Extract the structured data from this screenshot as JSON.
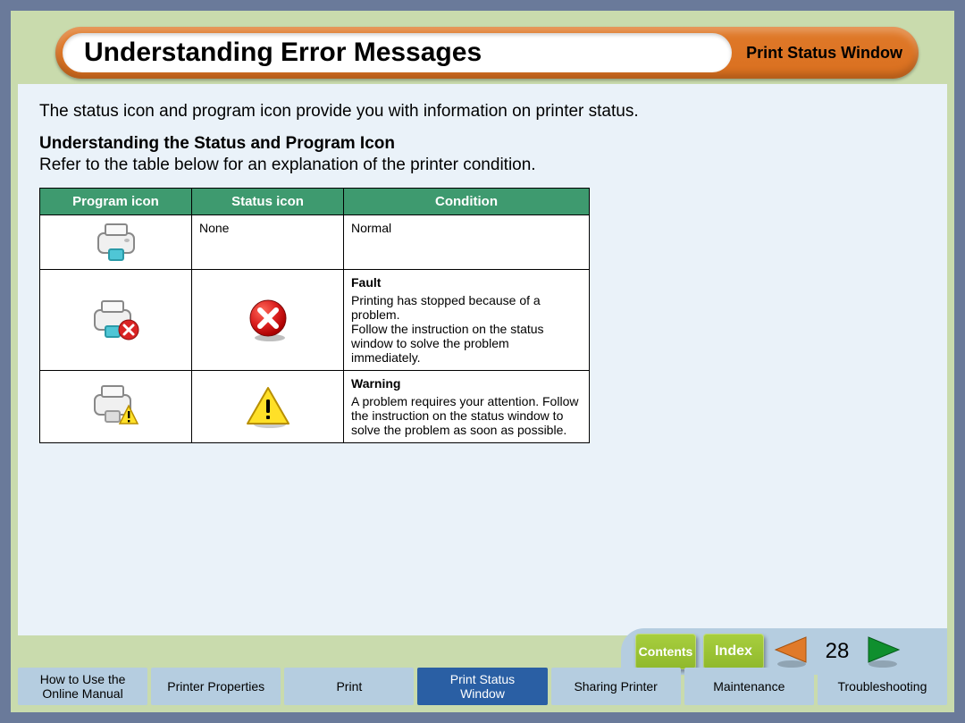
{
  "header": {
    "title": "Understanding Error Messages",
    "section": "Print Status Window"
  },
  "intro": "The status icon and program icon provide you with information on printer status.",
  "subheading": "Understanding the Status and Program Icon",
  "subdesc": "Refer to the table below for an explanation of the printer condition.",
  "table": {
    "headers": {
      "program": "Program icon",
      "status": "Status icon",
      "condition": "Condition"
    },
    "rows": [
      {
        "program_icon": "printer-normal-icon",
        "status_text": "None",
        "status_icon": "",
        "condition_title": "",
        "condition_body": "Normal"
      },
      {
        "program_icon": "printer-error-icon",
        "status_text": "",
        "status_icon": "error-circle-icon",
        "condition_title": "Fault",
        "condition_body": "Printing has stopped because of a problem.\nFollow the instruction on the status window to solve the problem immediately."
      },
      {
        "program_icon": "printer-warning-icon",
        "status_text": "",
        "status_icon": "warning-triangle-icon",
        "condition_title": "Warning",
        "condition_body": "A problem requires your attention. Follow the instruction on the status window to solve the problem as soon as possible."
      }
    ]
  },
  "nav": {
    "contents": "Contents",
    "index": "Index",
    "page": "28"
  },
  "tabs": [
    {
      "label": "How to Use the\nOnline Manual",
      "active": false
    },
    {
      "label": "Printer Properties",
      "active": false
    },
    {
      "label": "Print",
      "active": false
    },
    {
      "label": "Print Status\nWindow",
      "active": true
    },
    {
      "label": "Sharing Printer",
      "active": false
    },
    {
      "label": "Maintenance",
      "active": false
    },
    {
      "label": "Troubleshooting",
      "active": false
    }
  ]
}
